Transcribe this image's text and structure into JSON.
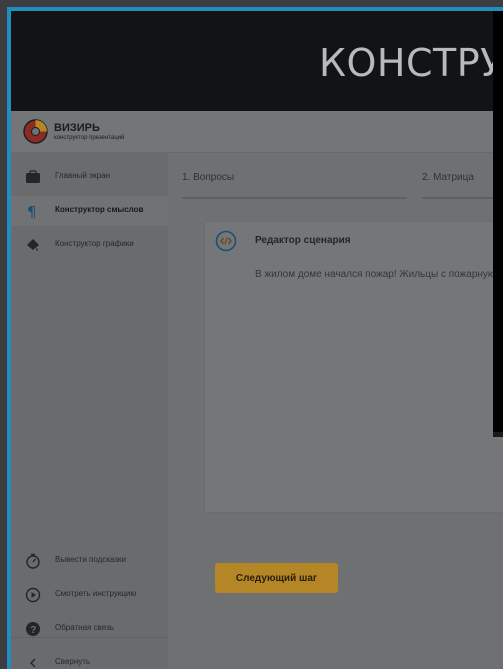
{
  "banner": {
    "title": "КОНСТРУ"
  },
  "app": {
    "logo_title": "ВИЗИРЬ",
    "logo_subtitle": "конструктор презентаций"
  },
  "sidebar": {
    "items": [
      {
        "label": "Главный экран",
        "icon": "briefcase-icon",
        "active": false
      },
      {
        "label": "Конструктор смыслов",
        "icon": "pilcrow-icon",
        "active": true
      },
      {
        "label": "Конструктор графики",
        "icon": "paint-bucket-icon",
        "active": false
      }
    ],
    "bottom_items": [
      {
        "label": "Вывести подсказки",
        "icon": "stopwatch-icon"
      },
      {
        "label": "Смотреть инструкцию",
        "icon": "play-icon"
      },
      {
        "label": "Обратная связь",
        "icon": "question-icon"
      },
      {
        "label": "Свернуть",
        "icon": "chevron-left-icon"
      }
    ]
  },
  "steps": [
    {
      "label": "1. Вопросы"
    },
    {
      "label": "2. Матрица"
    }
  ],
  "card": {
    "title": "Редактор сценария",
    "text": "В жилом доме начался пожар! Жильцы с пожарную службу..."
  },
  "actions": {
    "next_label": "Следующий шаг"
  },
  "colors": {
    "accent": "#b48626",
    "border": "#1e8fc0",
    "banner": "#121314"
  }
}
